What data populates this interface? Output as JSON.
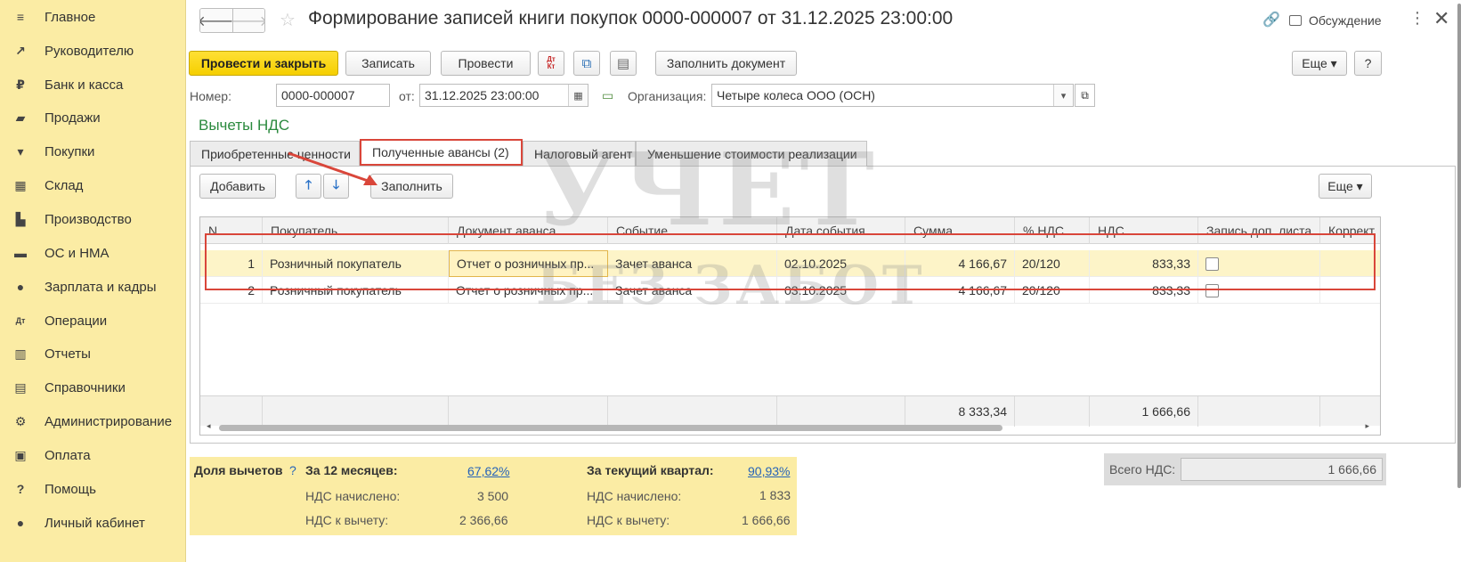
{
  "sidebar": {
    "items": [
      {
        "label": "Главное",
        "icon": "menu-icon",
        "glyph": "≡"
      },
      {
        "label": "Руководителю",
        "icon": "trend-icon",
        "glyph": "↗"
      },
      {
        "label": "Банк и касса",
        "icon": "coin-icon",
        "glyph": "₽"
      },
      {
        "label": "Продажи",
        "icon": "bag-icon",
        "glyph": "▰"
      },
      {
        "label": "Покупки",
        "icon": "cart-icon",
        "glyph": "▾"
      },
      {
        "label": "Склад",
        "icon": "warehouse-icon",
        "glyph": "▦"
      },
      {
        "label": "Производство",
        "icon": "factory-icon",
        "glyph": "▙"
      },
      {
        "label": "ОС и НМА",
        "icon": "truck-icon",
        "glyph": "▬"
      },
      {
        "label": "Зарплата и кадры",
        "icon": "person-icon",
        "glyph": "●"
      },
      {
        "label": "Операции",
        "icon": "dt-kt-icon",
        "glyph": "Дт"
      },
      {
        "label": "Отчеты",
        "icon": "bar-chart-icon",
        "glyph": "▥"
      },
      {
        "label": "Справочники",
        "icon": "books-icon",
        "glyph": "▤"
      },
      {
        "label": "Администрирование",
        "icon": "gear-icon",
        "glyph": "⚙"
      },
      {
        "label": "Оплата",
        "icon": "wallet-icon",
        "glyph": "▣"
      },
      {
        "label": "Помощь",
        "icon": "question-icon",
        "glyph": "?"
      },
      {
        "label": "Личный кабинет",
        "icon": "user-icon",
        "glyph": "●"
      }
    ]
  },
  "header": {
    "back_glyph": "🡐",
    "forward_glyph": "🡒",
    "star_glyph": "☆",
    "title": "Формирование записей книги покупок 0000-000007 от 31.12.2025 23:00:00",
    "link_glyph": "🔗",
    "discussion_label": "Обсуждение",
    "kebab_glyph": "⋮",
    "close_glyph": "✕"
  },
  "toolbar": {
    "post_close": "Провести и закрыть",
    "save": "Записать",
    "post": "Провести",
    "dt_kt_glyph": "Дт Кт",
    "struct_glyph": "⧉",
    "print_glyph": "▤",
    "fill_document": "Заполнить документ",
    "more": "Еще ▾",
    "help": "?"
  },
  "form": {
    "number_label": "Номер:",
    "number_value": "0000-000007",
    "date_label": "от:",
    "date_value": "31.12.2025 23:00:00",
    "calendar_glyph": "▦",
    "org_icon_glyph": "▭",
    "org_label": "Организация:",
    "org_value": "Четыре колеса ООО (ОСН)",
    "dropdown_glyph": "▾",
    "open_glyph": "⧉"
  },
  "section_title": "Вычеты НДС",
  "tabs": [
    {
      "label": "Приобретенные ценности"
    },
    {
      "label": "Полученные авансы (2)"
    },
    {
      "label": "Налоговый агент"
    },
    {
      "label": "Уменьшение стоимости реализации"
    }
  ],
  "table_toolbar": {
    "add": "Добавить",
    "up_glyph": "🡑",
    "down_glyph": "🡓",
    "fill": "Заполнить",
    "more": "Еще ▾"
  },
  "table": {
    "columns": [
      "N",
      "Покупатель",
      "Документ аванса",
      "Событие",
      "Дата события",
      "Сумма",
      "% НДС",
      "НДС",
      "Запись доп. листа",
      "Коррект"
    ],
    "rows": [
      {
        "n": "1",
        "buyer": "Розничный покупатель",
        "doc": "Отчет о розничных пр...",
        "event": "Зачет аванса",
        "date": "02.10.2025",
        "sum": "4 166,67",
        "rate": "20/120",
        "vat": "833,33"
      },
      {
        "n": "2",
        "buyer": "Розничный покупатель",
        "doc": "Отчет о розничных пр...",
        "event": "Зачет аванса",
        "date": "03.10.2025",
        "sum": "4 166,67",
        "rate": "20/120",
        "vat": "833,33"
      }
    ],
    "footer": {
      "sum": "8 333,34",
      "vat": "1 666,66"
    },
    "scroll_left_glyph": "◂",
    "scroll_right_glyph": "▸"
  },
  "deductions": {
    "label": "Доля вычетов",
    "help_glyph": "?",
    "months12_label": "За 12 месяцев:",
    "months12_pct": "67,62%",
    "quarter_label": "За текущий квартал:",
    "quarter_pct": "90,93%",
    "accrued_label": "НДС начислено:",
    "accrued_12": "3 500",
    "accrued_q": "1 833",
    "deduct_label": "НДС к вычету:",
    "deduct_12": "2 366,66",
    "deduct_q": "1 666,66"
  },
  "total": {
    "label": "Всего НДС:",
    "value": "1 666,66"
  },
  "watermark": {
    "line1": "УЧЕТ",
    "line2": "БЕЗ ЗАБОТ"
  },
  "colors": {
    "sidebar_bg": "#fbeca4",
    "primary_button": "#f5cf00",
    "section_title": "#2b8a3e",
    "highlight_border": "#d9463a",
    "link": "#2563b8"
  }
}
